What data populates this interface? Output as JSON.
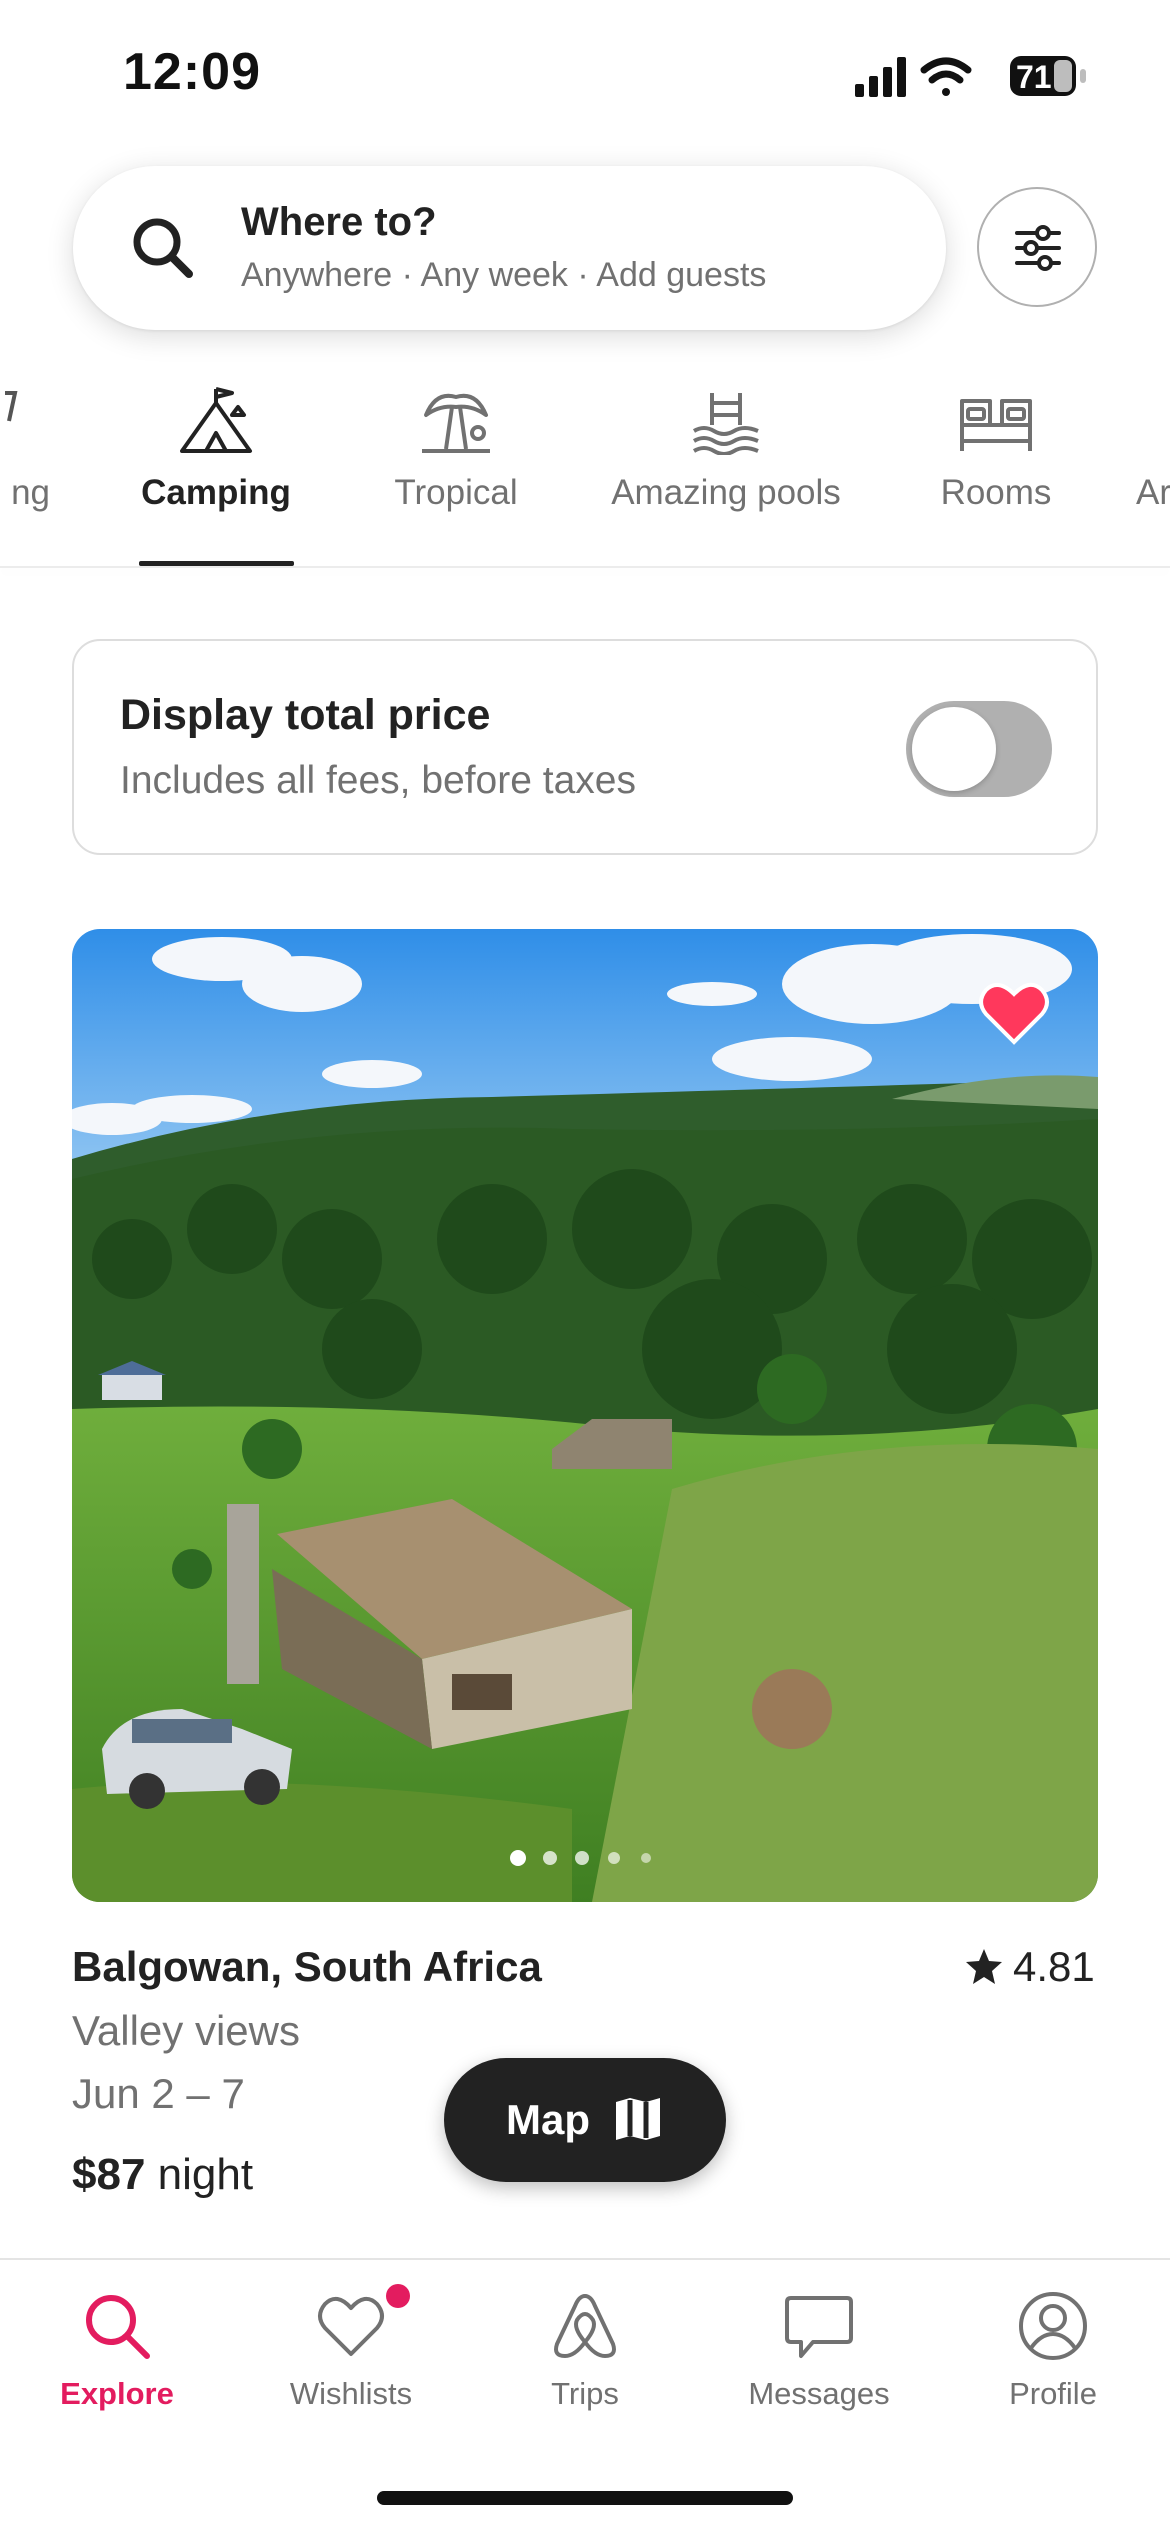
{
  "status_bar": {
    "time": "12:09",
    "battery": "71"
  },
  "search": {
    "title": "Where to?",
    "subtitle": "Anywhere · Any week · Add guests"
  },
  "categories": [
    {
      "label": "ng",
      "icon": "partial-icon",
      "active": false
    },
    {
      "label": "Camping",
      "icon": "tent-icon",
      "active": true
    },
    {
      "label": "Tropical",
      "icon": "palm-tree-icon",
      "active": false
    },
    {
      "label": "Amazing pools",
      "icon": "pool-icon",
      "active": false
    },
    {
      "label": "Rooms",
      "icon": "bed-icon",
      "active": false
    },
    {
      "label": "Ar",
      "icon": "partial-icon",
      "active": false
    }
  ],
  "price_toggle": {
    "title": "Display total price",
    "subtitle": "Includes all fees, before taxes",
    "enabled": false
  },
  "listing": {
    "location": "Balgowan, South Africa",
    "rating": "4.81",
    "description": "Valley views",
    "dates": "Jun 2 – 7",
    "price": "$87",
    "price_unit": "night",
    "photo_count": 5,
    "active_photo": 1,
    "favorited": true
  },
  "map_button": {
    "label": "Map"
  },
  "bottom_nav": [
    {
      "label": "Explore",
      "icon": "search-icon",
      "active": true
    },
    {
      "label": "Wishlists",
      "icon": "heart-icon",
      "active": false,
      "badge": true
    },
    {
      "label": "Trips",
      "icon": "airbnb-logo-icon",
      "active": false
    },
    {
      "label": "Messages",
      "icon": "message-icon",
      "active": false
    },
    {
      "label": "Profile",
      "icon": "profile-icon",
      "active": false
    }
  ],
  "colors": {
    "accent": "#e31c5f",
    "text": "#222222",
    "muted": "#717171"
  }
}
